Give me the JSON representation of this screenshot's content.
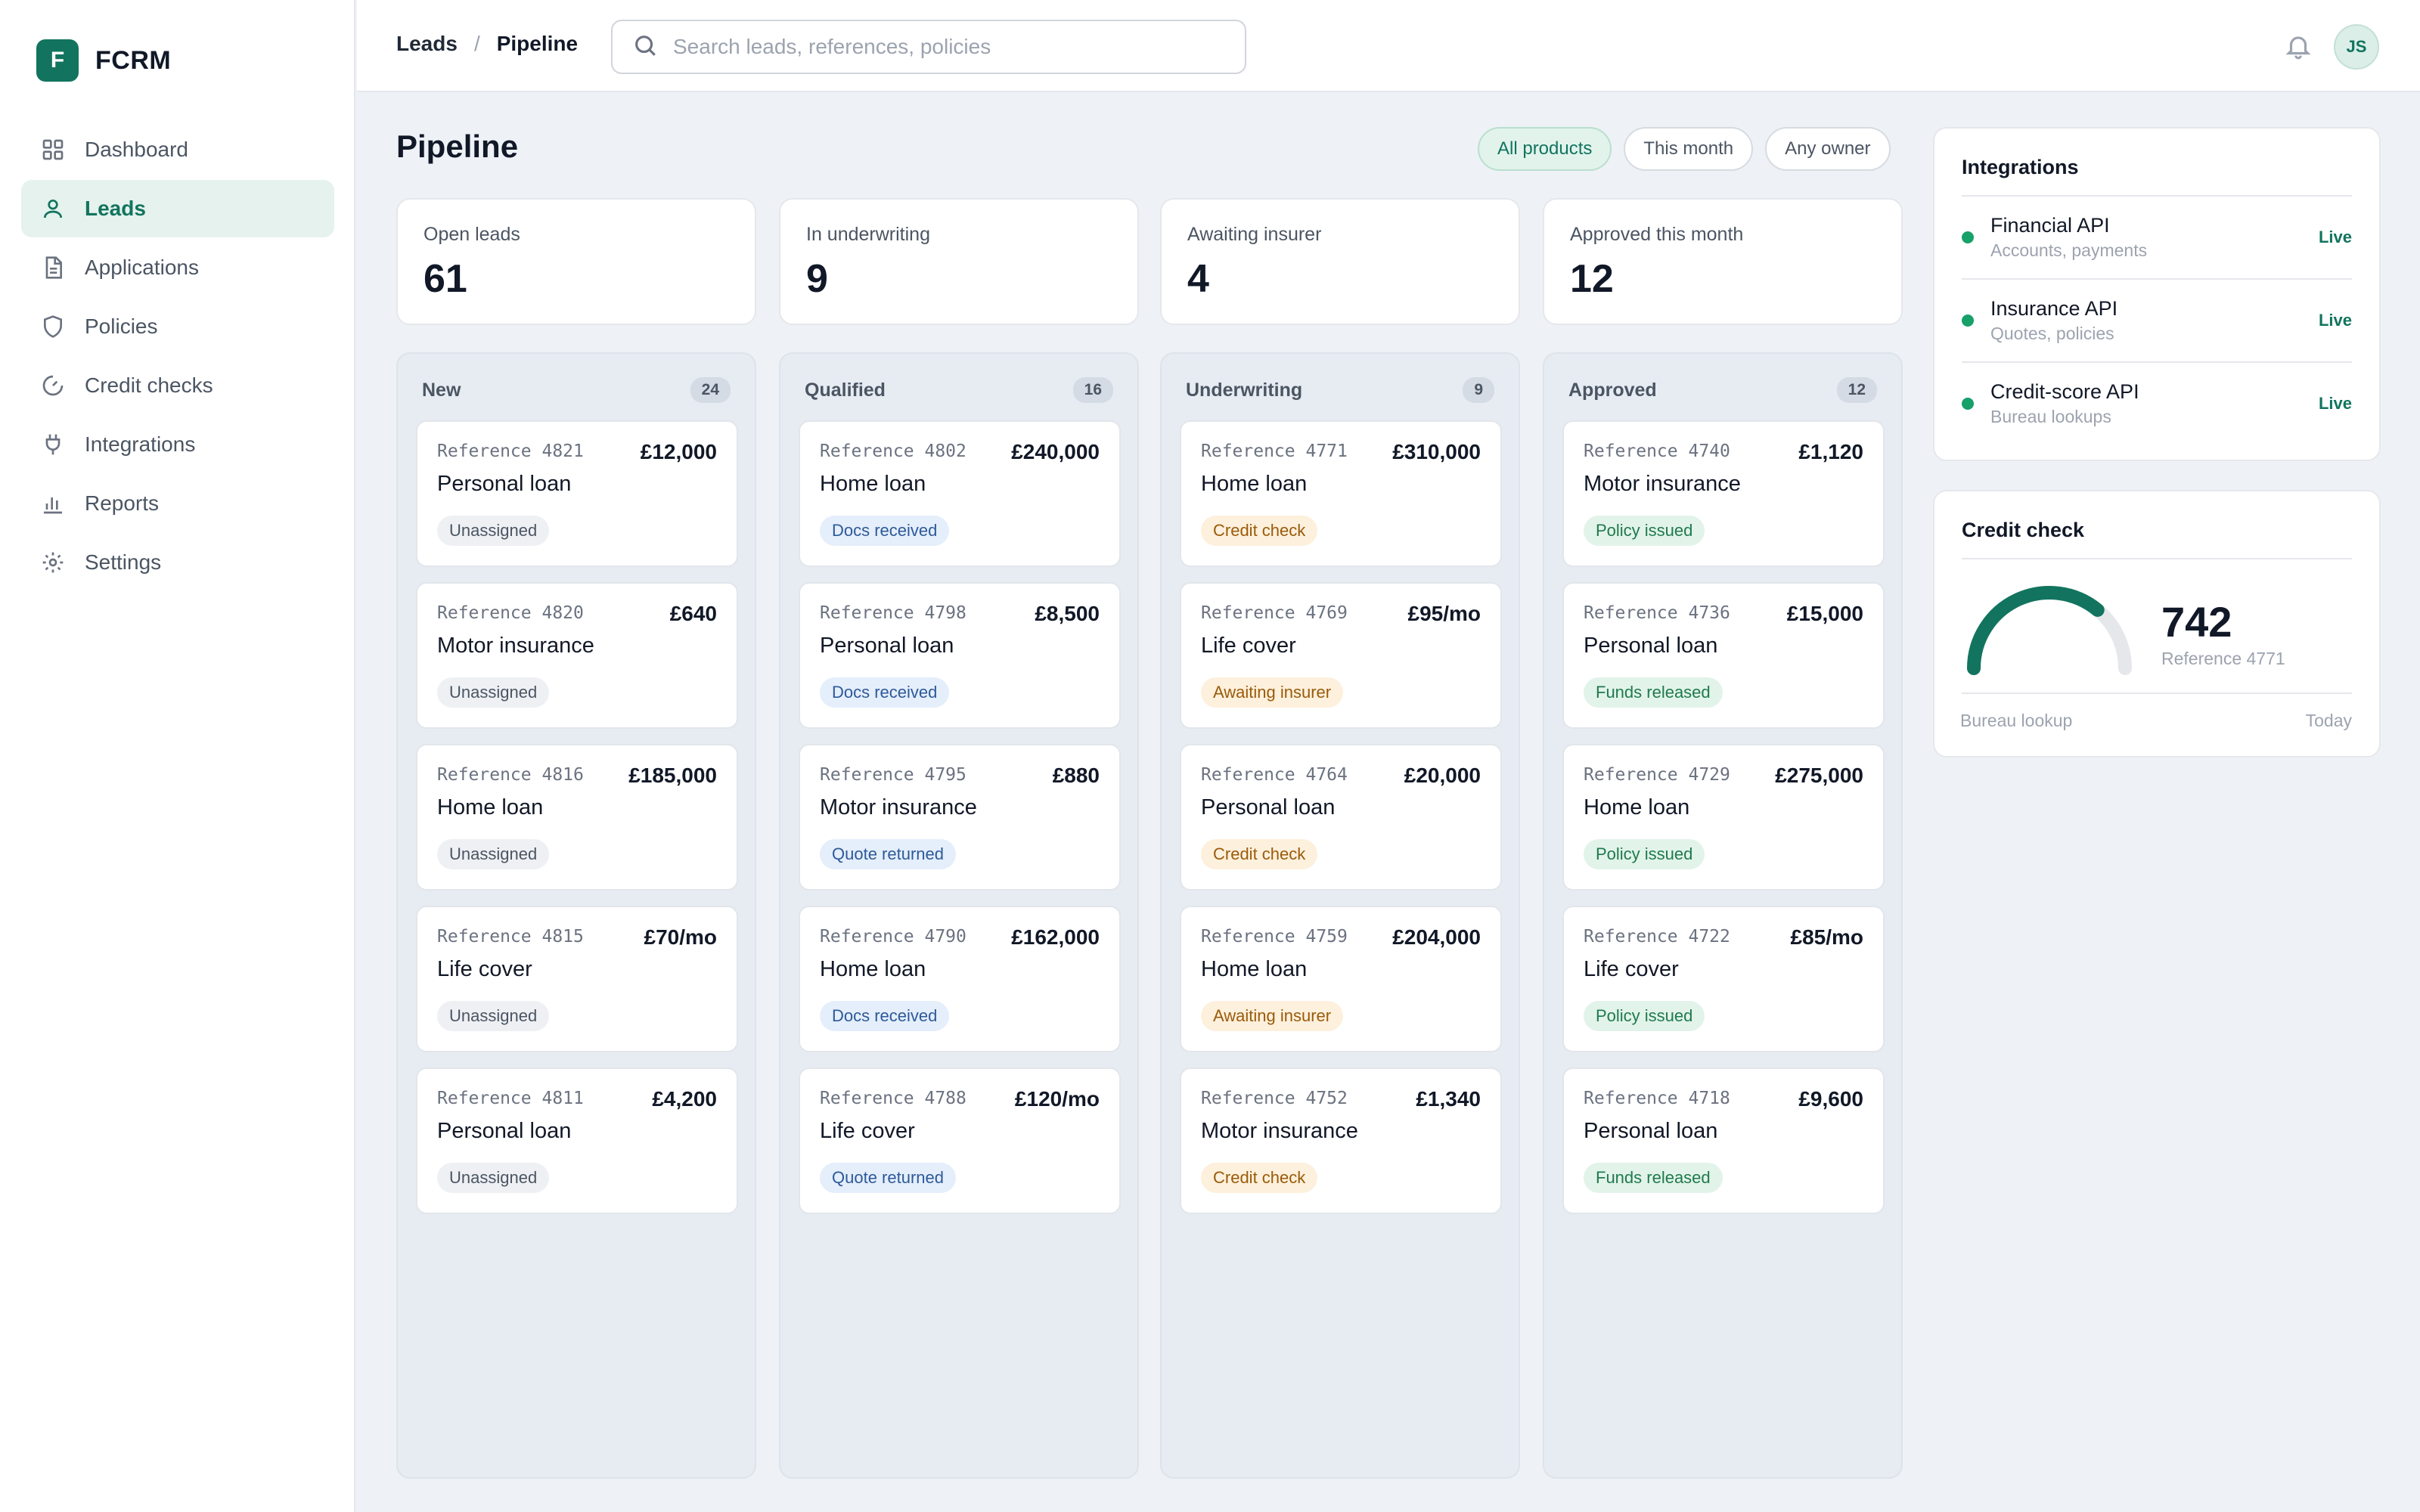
{
  "app": {
    "logo_letter": "F",
    "name": "FCRM"
  },
  "sidebar": {
    "items": [
      {
        "label": "Dashboard",
        "icon": "grid-icon"
      },
      {
        "label": "Leads",
        "icon": "user-icon",
        "active": true
      },
      {
        "label": "Applications",
        "icon": "document-icon"
      },
      {
        "label": "Policies",
        "icon": "shield-icon"
      },
      {
        "label": "Credit checks",
        "icon": "gauge-icon"
      },
      {
        "label": "Integrations",
        "icon": "plug-icon"
      },
      {
        "label": "Reports",
        "icon": "bar-chart-icon"
      },
      {
        "label": "Settings",
        "icon": "gear-icon"
      }
    ]
  },
  "topbar": {
    "breadcrumb": [
      "Leads",
      "Pipeline"
    ],
    "search_placeholder": "Search leads, references, policies",
    "avatar_initials": "JS"
  },
  "page": {
    "title": "Pipeline",
    "filters": [
      "All products",
      "This month",
      "Any owner"
    ]
  },
  "stats": [
    {
      "label": "Open leads",
      "value": "61"
    },
    {
      "label": "In underwriting",
      "value": "9"
    },
    {
      "label": "Awaiting insurer",
      "value": "4"
    },
    {
      "label": "Approved this month",
      "value": "12"
    }
  ],
  "columns": [
    {
      "title": "New",
      "count": "24",
      "cards": [
        {
          "ref": "Reference 4821",
          "amount": "£12,000",
          "product": "Personal loan",
          "status": "Unassigned",
          "tone": "gray"
        },
        {
          "ref": "Reference 4820",
          "amount": "£640",
          "product": "Motor insurance",
          "status": "Unassigned",
          "tone": "gray"
        },
        {
          "ref": "Reference 4816",
          "amount": "£185,000",
          "product": "Home loan",
          "status": "Unassigned",
          "tone": "gray"
        },
        {
          "ref": "Reference 4815",
          "amount": "£70/mo",
          "product": "Life cover",
          "status": "Unassigned",
          "tone": "gray"
        },
        {
          "ref": "Reference 4811",
          "amount": "£4,200",
          "product": "Personal loan",
          "status": "Unassigned",
          "tone": "gray"
        }
      ]
    },
    {
      "title": "Qualified",
      "count": "16",
      "cards": [
        {
          "ref": "Reference 4802",
          "amount": "£240,000",
          "product": "Home loan",
          "status": "Docs received",
          "tone": "blue"
        },
        {
          "ref": "Reference 4798",
          "amount": "£8,500",
          "product": "Personal loan",
          "status": "Docs received",
          "tone": "blue"
        },
        {
          "ref": "Reference 4795",
          "amount": "£880",
          "product": "Motor insurance",
          "status": "Quote returned",
          "tone": "blue"
        },
        {
          "ref": "Reference 4790",
          "amount": "£162,000",
          "product": "Home loan",
          "status": "Docs received",
          "tone": "blue"
        },
        {
          "ref": "Reference 4788",
          "amount": "£120/mo",
          "product": "Life cover",
          "status": "Quote returned",
          "tone": "blue"
        }
      ]
    },
    {
      "title": "Underwriting",
      "count": "9",
      "cards": [
        {
          "ref": "Reference 4771",
          "amount": "£310,000",
          "product": "Home loan",
          "status": "Credit check",
          "tone": "amber"
        },
        {
          "ref": "Reference 4769",
          "amount": "£95/mo",
          "product": "Life cover",
          "status": "Awaiting insurer",
          "tone": "amber"
        },
        {
          "ref": "Reference 4764",
          "amount": "£20,000",
          "product": "Personal loan",
          "status": "Credit check",
          "tone": "amber"
        },
        {
          "ref": "Reference 4759",
          "amount": "£204,000",
          "product": "Home loan",
          "status": "Awaiting insurer",
          "tone": "amber"
        },
        {
          "ref": "Reference 4752",
          "amount": "£1,340",
          "product": "Motor insurance",
          "status": "Credit check",
          "tone": "amber"
        }
      ]
    },
    {
      "title": "Approved",
      "count": "12",
      "cards": [
        {
          "ref": "Reference 4740",
          "amount": "£1,120",
          "product": "Motor insurance",
          "status": "Policy issued",
          "tone": "green"
        },
        {
          "ref": "Reference 4736",
          "amount": "£15,000",
          "product": "Personal loan",
          "status": "Funds released",
          "tone": "green"
        },
        {
          "ref": "Reference 4729",
          "amount": "£275,000",
          "product": "Home loan",
          "status": "Policy issued",
          "tone": "green"
        },
        {
          "ref": "Reference 4722",
          "amount": "£85/mo",
          "product": "Life cover",
          "status": "Policy issued",
          "tone": "green"
        },
        {
          "ref": "Reference 4718",
          "amount": "£9,600",
          "product": "Personal loan",
          "status": "Funds released",
          "tone": "green"
        }
      ]
    }
  ],
  "integrations": {
    "title": "Integrations",
    "items": [
      {
        "name": "Financial API",
        "sub": "Accounts, payments",
        "status": "Live"
      },
      {
        "name": "Insurance API",
        "sub": "Quotes, policies",
        "status": "Live"
      },
      {
        "name": "Credit-score API",
        "sub": "Bureau lookups",
        "status": "Live"
      }
    ]
  },
  "credit_check": {
    "title": "Credit check",
    "score": "742",
    "gauge_fraction": 0.72,
    "reference": "Reference 4771",
    "footer_left": "Bureau lookup",
    "footer_right": "Today"
  },
  "colors": {
    "accent": "#12745e",
    "live_dot": "#16a06a",
    "gauge_track": "#e5e7eb"
  }
}
